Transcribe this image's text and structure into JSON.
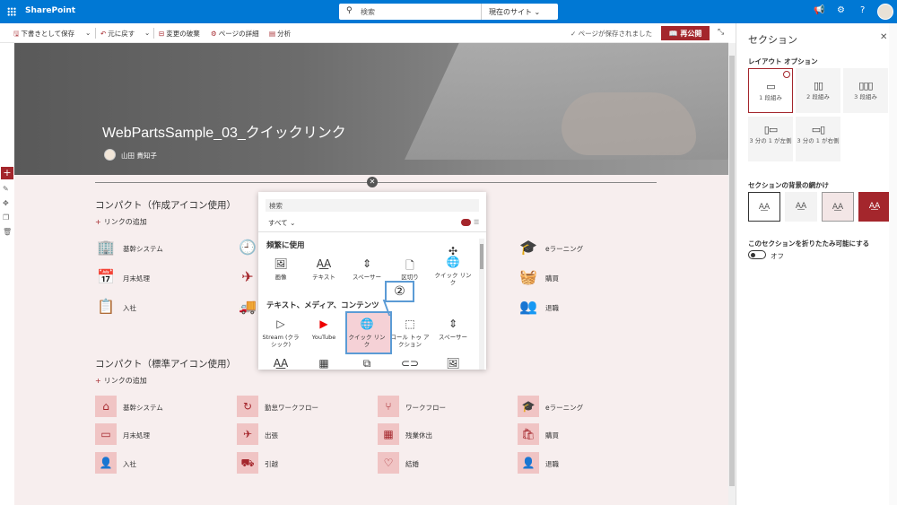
{
  "suite": {
    "brand": "SharePoint",
    "search_placeholder": "検索",
    "search_scope": "現在のサイト"
  },
  "command_bar": {
    "save_draft": "下書きとして保存",
    "undo": "元に戻す",
    "discard": "変更の破棄",
    "page_details": "ページの詳細",
    "analytics": "分析",
    "saved_status": "ページが保存されました",
    "republish": "再公開"
  },
  "hero": {
    "title": "WebPartsSample_03_クイックリンク",
    "author": "山田 貴知子"
  },
  "sections": [
    {
      "title": "コンパクト（作成アイコン使用）",
      "add_link": "リンクの追加",
      "links": [
        "基幹システム",
        "月末処理",
        "入社",
        "eラーニング",
        "購買",
        "退職"
      ]
    },
    {
      "title": "コンパクト（標準アイコン使用）",
      "add_link": "リンクの追加",
      "links": [
        "基幹システム",
        "勤怠ワークフロー",
        "ワークフロー",
        "eラーニング",
        "月末処理",
        "出張",
        "残業休出",
        "購買",
        "入社",
        "引越",
        "結婚",
        "退職"
      ]
    }
  ],
  "toolbox": {
    "search": "検索",
    "filter": "すべて",
    "frequent_label": "頻繁に使用",
    "frequent": [
      "画像",
      "テキスト",
      "スペーサー",
      "区切り",
      "クイック リンク"
    ],
    "media_label": "テキスト、メディア、コンテンツ",
    "media": [
      "Stream (クラシック)",
      "YouTube",
      "クイック リンク",
      "コール トゥ アクション",
      "スペーサー"
    ],
    "callout": "②"
  },
  "panel": {
    "title": "セクション",
    "layout_label": "レイアウト オプション",
    "layouts": [
      "1 段組み",
      "2 段組み",
      "3 段組み",
      "3 分の 1 が左側",
      "3 分の 1 が右側"
    ],
    "background_label": "セクションの背景の網かけ",
    "collapse_label": "このセクションを折りたたみ可能にする",
    "toggle_state": "オフ"
  },
  "colors": {
    "accent": "#a4262c",
    "suite": "#0078d4",
    "callout": "#5b9bd5"
  }
}
